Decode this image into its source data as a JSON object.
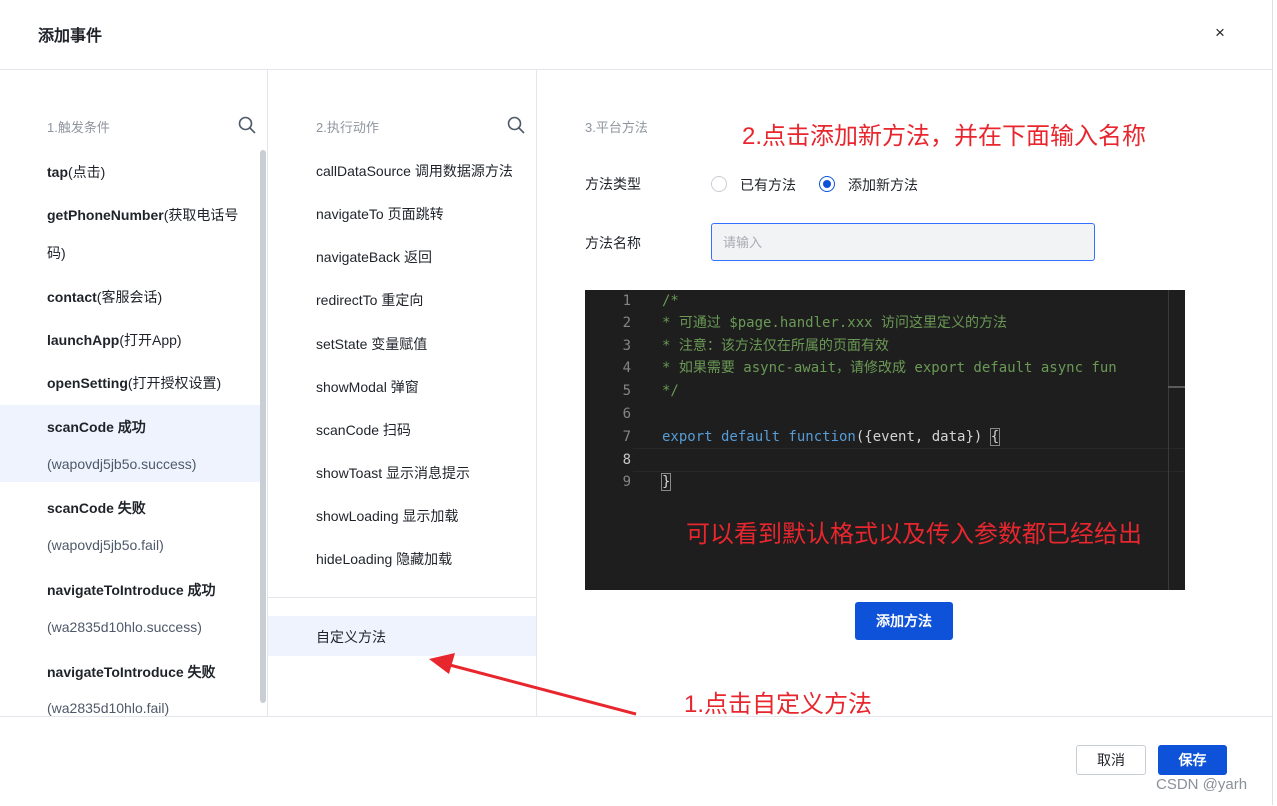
{
  "dialog": {
    "title": "添加事件",
    "close_glyph": "×"
  },
  "triggers": {
    "title": "1.触发条件",
    "items": [
      {
        "name_bold": "tap",
        "name_rest": "(点击)",
        "sub": ""
      },
      {
        "name_bold": "getPhoneNumber",
        "name_rest": "(获取电话号",
        "sub": "码)"
      },
      {
        "name_bold": "contact",
        "name_rest": "(客服会话)",
        "sub": ""
      },
      {
        "name_bold": "launchApp",
        "name_rest": "(打开App)",
        "sub": ""
      },
      {
        "name_bold": "openSetting",
        "name_rest": "(打开授权设置)",
        "sub": ""
      },
      {
        "name_bold": "scanCode 成功",
        "name_rest": "",
        "sub": "(wapovdj5jb5o.success)"
      },
      {
        "name_bold": "scanCode 失败",
        "name_rest": "",
        "sub": "(wapovdj5jb5o.fail)"
      },
      {
        "name_bold": "navigateToIntroduce 成功",
        "name_rest": "",
        "sub": "(wa2835d10hlo.success)"
      },
      {
        "name_bold": "navigateToIntroduce 失败",
        "name_rest": "",
        "sub": "(wa2835d10hlo.fail)"
      }
    ]
  },
  "actions": {
    "title": "2.执行动作",
    "items": [
      "callDataSource 调用数据源方法",
      "navigateTo 页面跳转",
      "navigateBack 返回",
      "redirectTo 重定向",
      "setState 变量赋值",
      "showModal 弹窗",
      "scanCode 扫码",
      "showToast 显示消息提示",
      "showLoading 显示加载",
      "hideLoading 隐藏加载"
    ],
    "custom": "自定义方法"
  },
  "platform": {
    "title": "3.平台方法",
    "method_type_label": "方法类型",
    "radio_existing": "已有方法",
    "radio_new": "添加新方法",
    "method_name_label": "方法名称",
    "method_name_placeholder": "请输入",
    "method_name_value": "",
    "add_method_button": "添加方法"
  },
  "editor": {
    "lines": [
      {
        "n": "1",
        "text": "/*"
      },
      {
        "n": "2",
        "text": "* 可通过 $page.handler.xxx 访问这里定义的方法"
      },
      {
        "n": "3",
        "text": "* 注意：该方法仅在所属的页面有效"
      },
      {
        "n": "4",
        "text": "* 如果需要 async-await，请修改成 export default async fun"
      },
      {
        "n": "5",
        "text": "*/"
      },
      {
        "n": "6",
        "text": ""
      },
      {
        "n": "7",
        "kw": "export default function",
        "rest": "({event, data}) ",
        "brace": "{"
      },
      {
        "n": "8",
        "text": ""
      },
      {
        "n": "9",
        "brace": "}"
      }
    ]
  },
  "footer": {
    "cancel": "取消",
    "save": "保存"
  },
  "annotations": {
    "step2": "2.点击添加新方法，并在下面输入名称",
    "editor_note": "可以看到默认格式以及传入参数都已经给出",
    "step1": "1.点击自定义方法",
    "arrow_color": "#e8262e"
  },
  "watermark": "CSDN @yarh",
  "colors": {
    "primary": "#0d52d9",
    "selected_bg": "#eef3fd",
    "annotation": "#e8262e"
  }
}
